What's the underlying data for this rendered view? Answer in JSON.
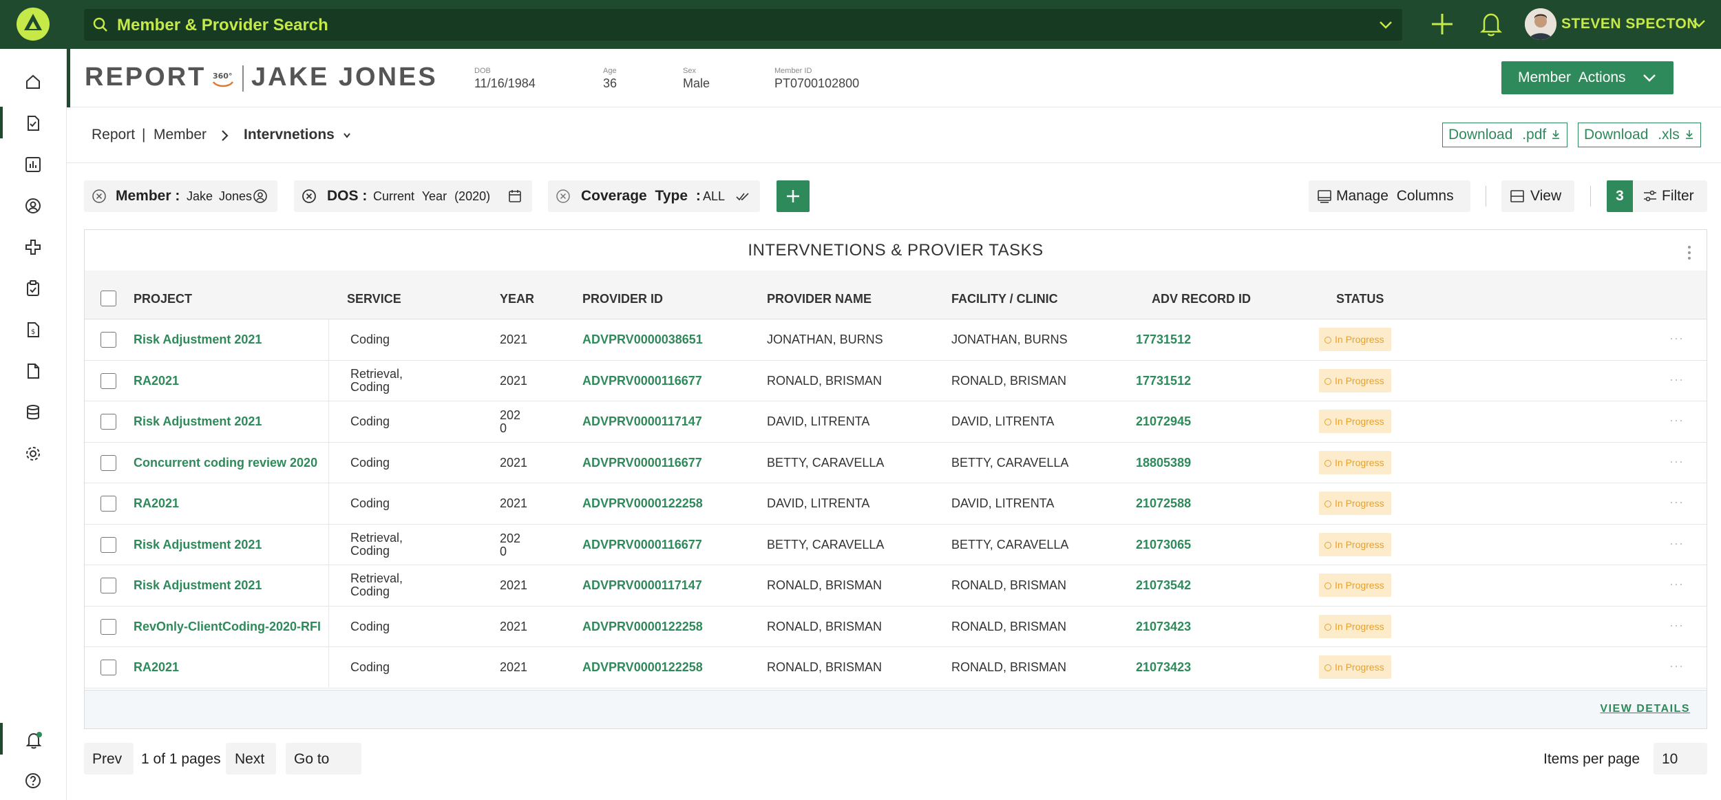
{
  "topbar": {
    "search_placeholder": "Member & Provider Search",
    "user_name": "STEVEN SPECTON"
  },
  "header": {
    "report_label": "REPORT",
    "badge": "360°",
    "member_name": "JAKE JONES",
    "dob_label": "DOB",
    "dob": "11/16/1984",
    "age_label": "Age",
    "age": "36",
    "sex_label": "Sex",
    "sex": "Male",
    "member_id_label": "Member ID",
    "member_id": "PT0700102800",
    "actions_button": "Member Actions"
  },
  "breadcrumb": {
    "items": [
      "Report",
      "Member"
    ],
    "separator": "|",
    "current": "Intervnetions"
  },
  "downloads": {
    "pdf": "Download .pdf",
    "xls": "Download .xls"
  },
  "filters": {
    "member_key": "Member :",
    "member_value": "Jake Jones",
    "dos_key": "DOS :",
    "dos_value": "Current Year (2020)",
    "coverage_key": "Coverage Type :",
    "coverage_value": "ALL"
  },
  "toolbar": {
    "manage_columns": "Manage Columns",
    "view": "View",
    "filter_count": "3",
    "filter": "Filter"
  },
  "table": {
    "title": "INTERVNETIONS & PROVIER TASKS",
    "columns": [
      "PROJECT",
      "SERVICE",
      "YEAR",
      "PROVIDER ID",
      "PROVIDER NAME",
      "FACILITY / CLINIC",
      "ADV RECORD ID",
      "STATUS"
    ],
    "rows": [
      {
        "project": "Risk Adjustment 2021",
        "service": "Coding",
        "year": "2021",
        "provider_id": "ADVPRV0000038651",
        "provider_name": "JONATHAN, BURNS",
        "facility": "JONATHAN, BURNS",
        "record_id": "17731512",
        "status": "In Progress"
      },
      {
        "project": "RA2021",
        "service": "Retrieval, Coding",
        "year": "2021",
        "provider_id": "ADVPRV0000116677",
        "provider_name": "RONALD, BRISMAN",
        "facility": "RONALD, BRISMAN",
        "record_id": "17731512",
        "status": "In Progress"
      },
      {
        "project": "Risk Adjustment 2021",
        "service": "Coding",
        "year": "2020",
        "provider_id": "ADVPRV0000117147",
        "provider_name": "DAVID, LITRENTA",
        "facility": "DAVID, LITRENTA",
        "record_id": "21072945",
        "status": "In Progress"
      },
      {
        "project": "Concurrent coding review 2020",
        "service": "Coding",
        "year": "2021",
        "provider_id": "ADVPRV0000116677",
        "provider_name": "BETTY, CARAVELLA",
        "facility": "BETTY, CARAVELLA",
        "record_id": "18805389",
        "status": "In Progress"
      },
      {
        "project": "RA2021",
        "service": "Coding",
        "year": "2021",
        "provider_id": "ADVPRV0000122258",
        "provider_name": "DAVID, LITRENTA",
        "facility": "DAVID, LITRENTA",
        "record_id": "21072588",
        "status": "In Progress"
      },
      {
        "project": "Risk Adjustment 2021",
        "service": "Retrieval, Coding",
        "year": "2020",
        "provider_id": "ADVPRV0000116677",
        "provider_name": "BETTY, CARAVELLA",
        "facility": "BETTY, CARAVELLA",
        "record_id": "21073065",
        "status": "In Progress"
      },
      {
        "project": "Risk Adjustment 2021",
        "service": "Retrieval, Coding",
        "year": "2021",
        "provider_id": "ADVPRV0000117147",
        "provider_name": "RONALD, BRISMAN",
        "facility": "RONALD, BRISMAN",
        "record_id": "21073542",
        "status": "In Progress"
      },
      {
        "project": "RevOnly-ClientCoding-2020-RFI",
        "service": "Coding",
        "year": "2021",
        "provider_id": "ADVPRV0000122258",
        "provider_name": "RONALD, BRISMAN",
        "facility": "RONALD, BRISMAN",
        "record_id": "21073423",
        "status": "In Progress"
      },
      {
        "project": "RA2021",
        "service": "Coding",
        "year": "2021",
        "provider_id": "ADVPRV0000122258",
        "provider_name": "RONALD, BRISMAN",
        "facility": "RONALD, BRISMAN",
        "record_id": "21073423",
        "status": "In Progress"
      }
    ],
    "row_more": "···",
    "view_details": "VIEW DETAILS"
  },
  "pagination": {
    "prev": "Prev",
    "page_info": "1 of 1 pages",
    "next": "Next",
    "goto": "Go to",
    "items_per_page_label": "Items per page",
    "items_per_page": "10"
  },
  "colors": {
    "topbar_bg": "#1f4a2e",
    "accent_lime": "#c6e94a",
    "brand_green": "#2e8a5a",
    "status_bg": "#fdeccb",
    "status_text": "#e6a12a"
  },
  "icons": {
    "sidebar": [
      "home-icon",
      "report-icon",
      "chart-icon",
      "user-icon",
      "medical-cross-icon",
      "clipboard-icon",
      "billing-icon",
      "document-icon",
      "database-icon",
      "settings-icon"
    ],
    "sidebar_bottom": [
      "notification-icon",
      "help-icon"
    ]
  }
}
